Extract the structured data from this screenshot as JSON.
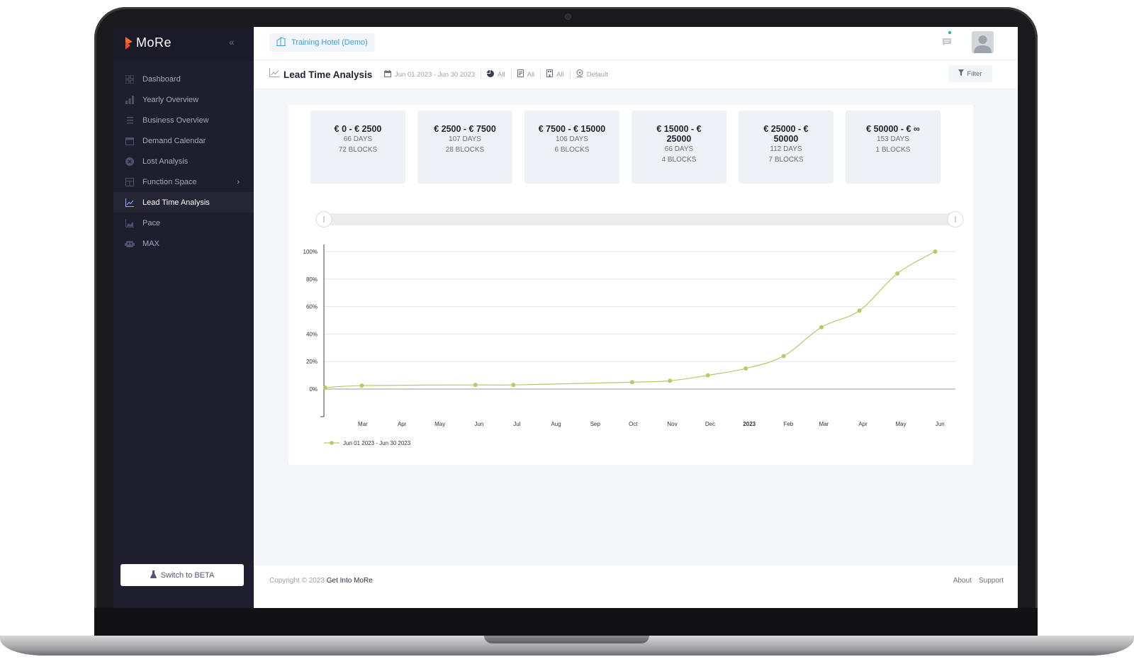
{
  "app": {
    "name": "MoRe"
  },
  "sidebar": {
    "items": [
      {
        "label": "Dashboard",
        "icon": "dashboard-icon"
      },
      {
        "label": "Yearly Overview",
        "icon": "bar-chart-icon"
      },
      {
        "label": "Business Overview",
        "icon": "list-icon"
      },
      {
        "label": "Demand Calendar",
        "icon": "calendar-icon"
      },
      {
        "label": "Lost Analysis",
        "icon": "close-circle-icon"
      },
      {
        "label": "Function Space",
        "icon": "table-icon"
      },
      {
        "label": "Lead Time Analysis",
        "icon": "trend-icon",
        "active": true
      },
      {
        "label": "Pace",
        "icon": "area-chart-icon"
      },
      {
        "label": "MAX",
        "icon": "robot-icon"
      }
    ],
    "beta_label": "Switch to BETA"
  },
  "topbar": {
    "hotel": "Training Hotel (Demo)"
  },
  "subheader": {
    "title": "Lead Time Analysis",
    "date_range": "Jun 01 2023 - Jun 30 2023",
    "filter_1": "All",
    "filter_2": "All",
    "filter_3": "All",
    "view": "Default",
    "filter_label": "Filter"
  },
  "buckets": [
    {
      "title": "€ 0 - € 2500",
      "days": "66 DAYS",
      "blocks": "72 BLOCKS"
    },
    {
      "title": "€ 2500 - € 7500",
      "days": "107 DAYS",
      "blocks": "28 BLOCKS"
    },
    {
      "title": "€ 7500 - € 15000",
      "days": "106 DAYS",
      "blocks": "6 BLOCKS"
    },
    {
      "title": "€ 15000 - € 25000",
      "days": "66 DAYS",
      "blocks": "4 BLOCKS"
    },
    {
      "title": "€ 25000 - € 50000",
      "days": "112 DAYS",
      "blocks": "7 BLOCKS"
    },
    {
      "title": "€ 50000 - € ∞",
      "days": "153 DAYS",
      "blocks": "1 BLOCKS"
    }
  ],
  "chart_data": {
    "type": "line",
    "title": "",
    "xlabel": "",
    "ylabel": "",
    "x_tick_labels": [
      "Mar",
      "Apr",
      "May",
      "Jun",
      "Jul",
      "Aug",
      "Sep",
      "Oct",
      "Nov",
      "Dec",
      "2023",
      "Feb",
      "Mar",
      "Apr",
      "May",
      "Jun"
    ],
    "y_tick_labels": [
      "0%",
      "20%",
      "40%",
      "60%",
      "80%",
      "100%"
    ],
    "ylim": [
      0,
      100
    ],
    "xlim": [
      "2022-02-15",
      "2023-06-30"
    ],
    "grid": true,
    "legend": "bottom-left",
    "color": "#b7c96a",
    "series": [
      {
        "name": "Jun 01 2023 - Jun 30 2023",
        "points": [
          {
            "x": "2022-02-16",
            "y": 1
          },
          {
            "x": "2022-03-17",
            "y": 2.5
          },
          {
            "x": "2022-06-15",
            "y": 3
          },
          {
            "x": "2022-07-15",
            "y": 3
          },
          {
            "x": "2022-10-17",
            "y": 5
          },
          {
            "x": "2022-11-16",
            "y": 6
          },
          {
            "x": "2022-12-16",
            "y": 10
          },
          {
            "x": "2023-01-15",
            "y": 15
          },
          {
            "x": "2023-02-14",
            "y": 24
          },
          {
            "x": "2023-03-16",
            "y": 45
          },
          {
            "x": "2023-04-15",
            "y": 57
          },
          {
            "x": "2023-05-15",
            "y": 84
          },
          {
            "x": "2023-06-14",
            "y": 100
          }
        ]
      }
    ]
  },
  "footer": {
    "copyright": "Copyright © 2023",
    "company": "Get Into MoRe",
    "about": "About",
    "support": "Support"
  }
}
